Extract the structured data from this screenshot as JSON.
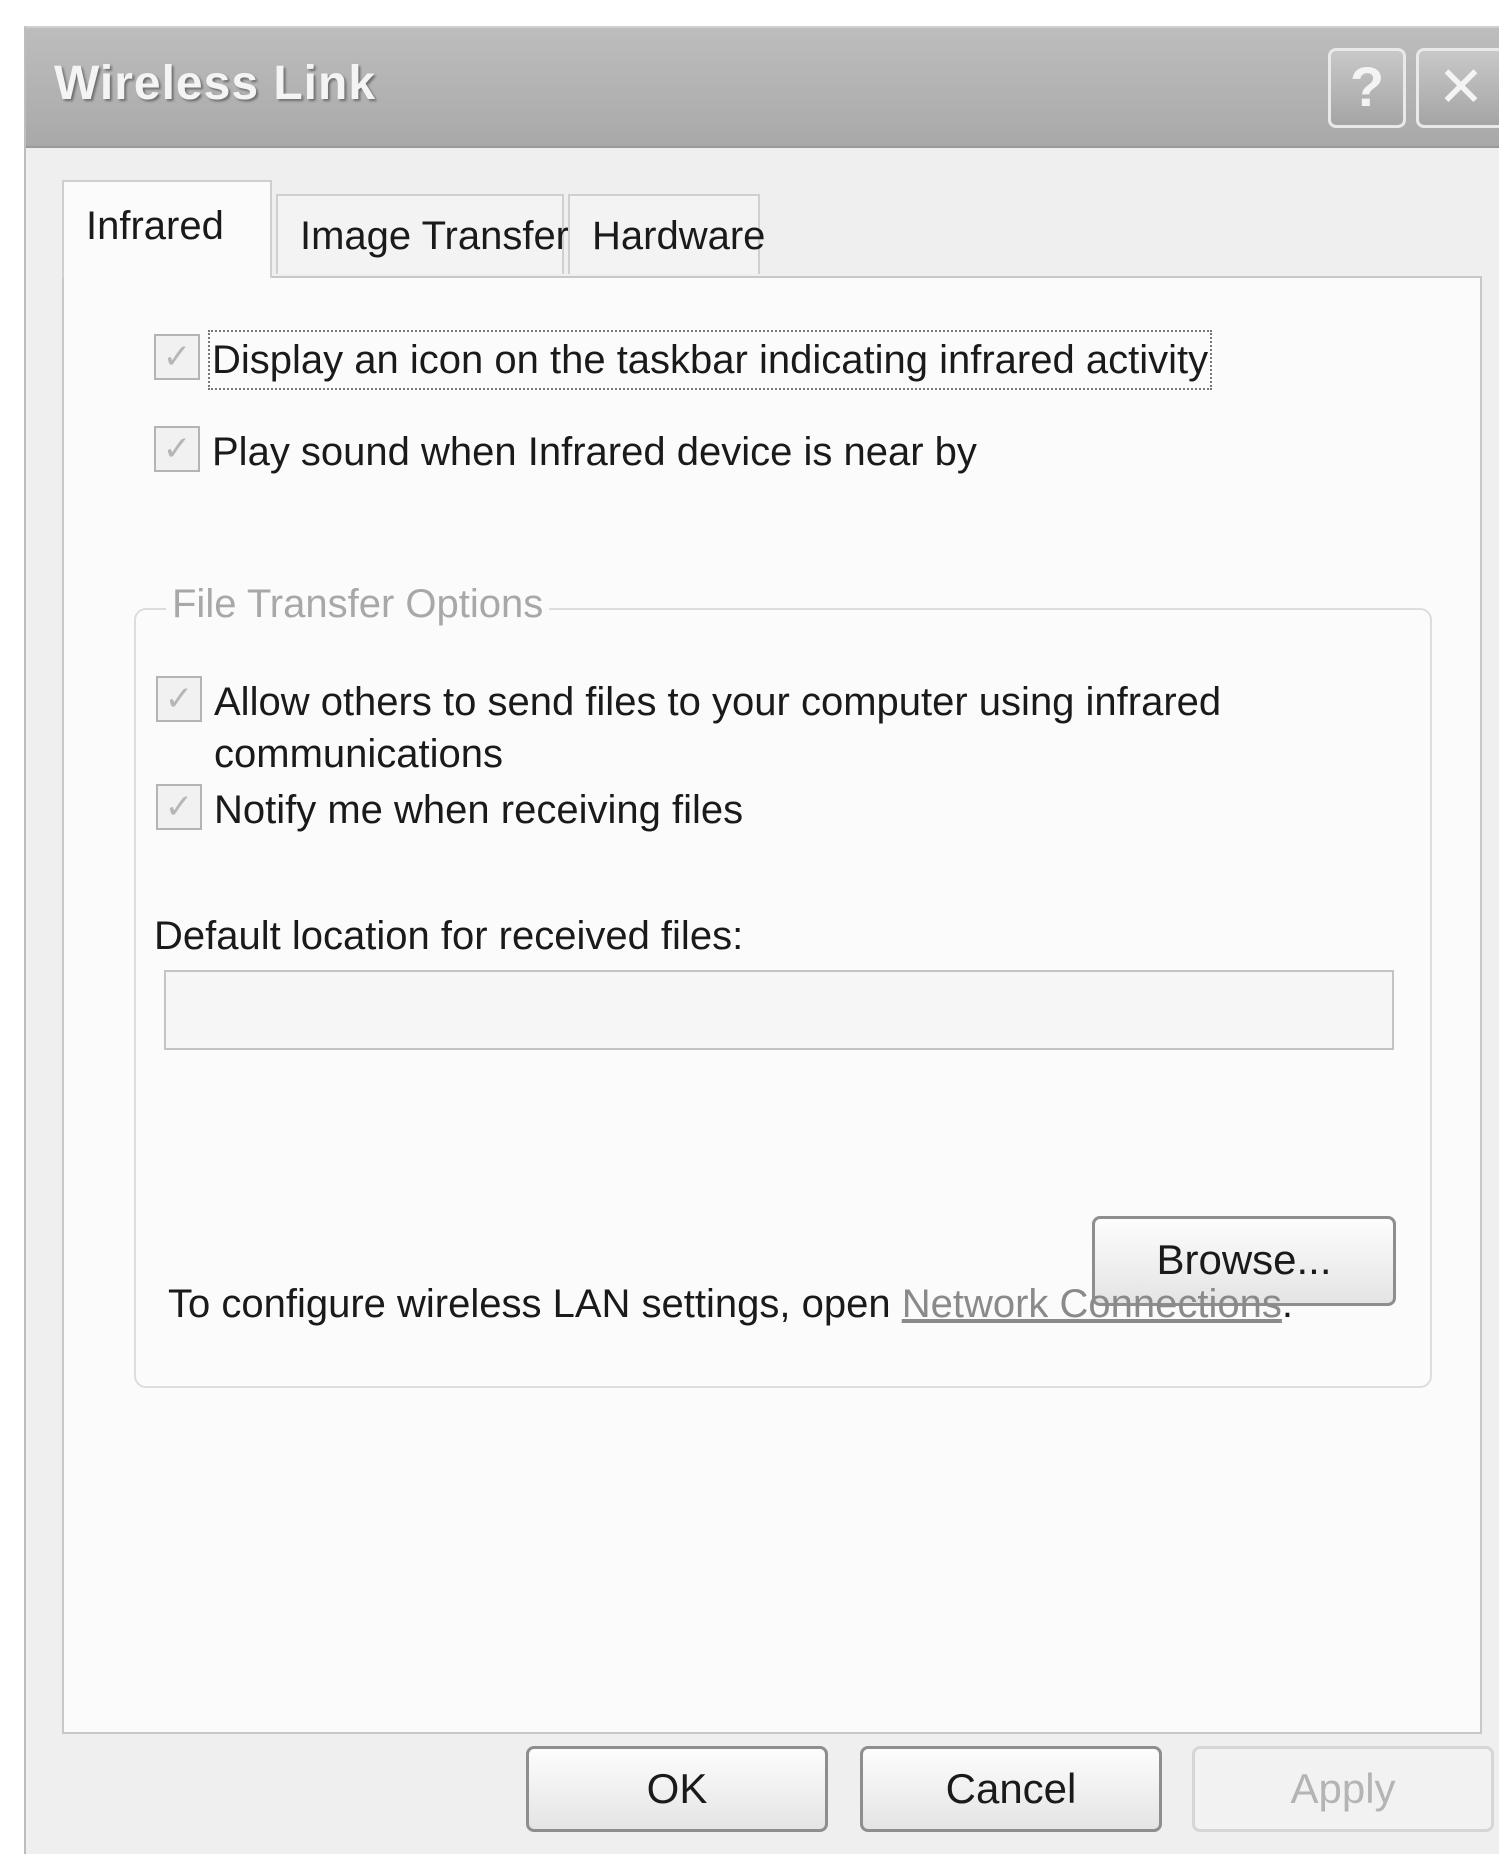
{
  "window": {
    "title": "Wireless Link",
    "help_glyph": "?",
    "close_glyph": "✕"
  },
  "tabs": [
    {
      "label": "Infrared",
      "active": true
    },
    {
      "label": "Image Transfer",
      "active": false
    },
    {
      "label": "Hardware",
      "active": false
    }
  ],
  "infrared": {
    "display_icon": {
      "label": "Display an icon on the taskbar indicating infrared activity",
      "checked": true
    },
    "play_sound": {
      "label": "Play sound when Infrared device is near by",
      "checked": true
    },
    "file_transfer": {
      "legend": "File Transfer Options",
      "allow_others": {
        "label_line1": "Allow others to send files to your computer using infrared",
        "label_line2": "communications",
        "checked": true
      },
      "notify": {
        "label": "Notify me when receiving files",
        "checked": true
      },
      "default_location_label": "Default location for received files:",
      "default_location_value": "",
      "browse_label": "Browse..."
    },
    "footer_text": "To configure wireless LAN settings, open ",
    "footer_link": "Network Connections",
    "footer_end": "."
  },
  "buttons": {
    "ok": "OK",
    "cancel": "Cancel",
    "apply": "Apply"
  },
  "check_glyph": "✓"
}
